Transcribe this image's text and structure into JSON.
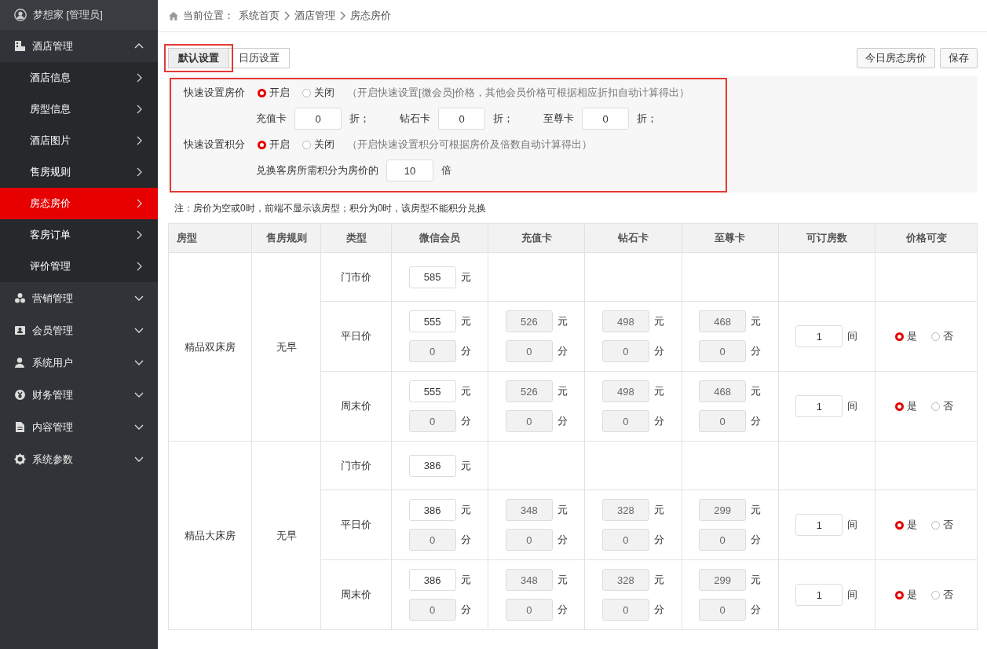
{
  "sidebar": {
    "user": "梦想家 [管理员]",
    "menu": [
      {
        "label": "酒店管理",
        "expanded": true,
        "children": [
          {
            "label": "酒店信息",
            "selected": false
          },
          {
            "label": "房型信息",
            "selected": false
          },
          {
            "label": "酒店图片",
            "selected": false
          },
          {
            "label": "售房规则",
            "selected": false
          },
          {
            "label": "房态房价",
            "selected": true
          },
          {
            "label": "客房订单",
            "selected": false
          },
          {
            "label": "评价管理",
            "selected": false
          }
        ]
      },
      {
        "label": "营销管理",
        "expanded": false
      },
      {
        "label": "会员管理",
        "expanded": false
      },
      {
        "label": "系统用户",
        "expanded": false
      },
      {
        "label": "财务管理",
        "expanded": false
      },
      {
        "label": "内容管理",
        "expanded": false
      },
      {
        "label": "系统参数",
        "expanded": false
      }
    ]
  },
  "breadcrumb": {
    "prefix": "当前位置：",
    "items": [
      "系统首页",
      "酒店管理",
      "房态房价"
    ]
  },
  "tabs": [
    {
      "label": "默认设置",
      "selected": true,
      "annotated": true
    },
    {
      "label": "日历设置",
      "selected": false,
      "annotated": false
    }
  ],
  "toolbar_buttons": [
    "今日房态房价",
    "保存"
  ],
  "quick_settings": {
    "annotated": true,
    "price": {
      "label": "快速设置房价",
      "options": [
        {
          "label": "开启",
          "selected": true
        },
        {
          "label": "关闭",
          "selected": false
        }
      ],
      "hint": "（开启快速设置[微会员]价格，其他会员价格可根据相应折扣自动计算得出）",
      "discounts": [
        {
          "label": "充值卡",
          "value": "0",
          "unit": "折；"
        },
        {
          "label": "钻石卡",
          "value": "0",
          "unit": "折；"
        },
        {
          "label": "至尊卡",
          "value": "0",
          "unit": "折；"
        }
      ]
    },
    "points": {
      "label": "快速设置积分",
      "options": [
        {
          "label": "开启",
          "selected": true
        },
        {
          "label": "关闭",
          "selected": false
        }
      ],
      "hint": "（开启快速设置积分可根据房价及倍数自动计算得出）",
      "ratio_label": "兑换客房所需积分为房价的",
      "ratio_value": "10",
      "ratio_unit": "倍"
    }
  },
  "note": "注：房价为空或0时，前端不显示该房型；积分为0时，该房型不能积分兑换",
  "table": {
    "columns": [
      "房型",
      "售房规则",
      "类型",
      "微信会员",
      "充值卡",
      "钻石卡",
      "至尊卡",
      "可订房数",
      "价格可变"
    ],
    "rooms": [
      {
        "name": "精品双床房",
        "rule": "无早",
        "rates": [
          {
            "kind": "market",
            "type": "门市价",
            "price": {
              "value": "585",
              "unit": "元"
            }
          },
          {
            "kind": "priced",
            "type": "平日价",
            "prices": [
              {
                "value": "555",
                "unit": "元",
                "disabled": false
              },
              {
                "value": "526",
                "unit": "元",
                "disabled": true
              },
              {
                "value": "498",
                "unit": "元",
                "disabled": true
              },
              {
                "value": "468",
                "unit": "元",
                "disabled": true
              }
            ],
            "points": [
              {
                "value": "0",
                "unit": "分",
                "disabled": true
              },
              {
                "value": "0",
                "unit": "分",
                "disabled": true
              },
              {
                "value": "0",
                "unit": "分",
                "disabled": true
              },
              {
                "value": "0",
                "unit": "分",
                "disabled": true
              }
            ],
            "rooms": {
              "value": "1",
              "unit": "间"
            },
            "options": [
              {
                "label": "是",
                "selected": true
              },
              {
                "label": "否",
                "selected": false
              }
            ]
          },
          {
            "kind": "priced",
            "type": "周末价",
            "prices": [
              {
                "value": "555",
                "unit": "元",
                "disabled": false
              },
              {
                "value": "526",
                "unit": "元",
                "disabled": true
              },
              {
                "value": "498",
                "unit": "元",
                "disabled": true
              },
              {
                "value": "468",
                "unit": "元",
                "disabled": true
              }
            ],
            "points": [
              {
                "value": "0",
                "unit": "分",
                "disabled": true
              },
              {
                "value": "0",
                "unit": "分",
                "disabled": true
              },
              {
                "value": "0",
                "unit": "分",
                "disabled": true
              },
              {
                "value": "0",
                "unit": "分",
                "disabled": true
              }
            ],
            "rooms": {
              "value": "1",
              "unit": "间"
            },
            "options": [
              {
                "label": "是",
                "selected": true
              },
              {
                "label": "否",
                "selected": false
              }
            ]
          }
        ]
      },
      {
        "name": "精品大床房",
        "rule": "无早",
        "rates": [
          {
            "kind": "market",
            "type": "门市价",
            "price": {
              "value": "386",
              "unit": "元"
            }
          },
          {
            "kind": "priced",
            "type": "平日价",
            "prices": [
              {
                "value": "386",
                "unit": "元",
                "disabled": false
              },
              {
                "value": "348",
                "unit": "元",
                "disabled": true
              },
              {
                "value": "328",
                "unit": "元",
                "disabled": true
              },
              {
                "value": "299",
                "unit": "元",
                "disabled": true
              }
            ],
            "points": [
              {
                "value": "0",
                "unit": "分",
                "disabled": true
              },
              {
                "value": "0",
                "unit": "分",
                "disabled": true
              },
              {
                "value": "0",
                "unit": "分",
                "disabled": true
              },
              {
                "value": "0",
                "unit": "分",
                "disabled": true
              }
            ],
            "rooms": {
              "value": "1",
              "unit": "间"
            },
            "options": [
              {
                "label": "是",
                "selected": true
              },
              {
                "label": "否",
                "selected": false
              }
            ]
          },
          {
            "kind": "priced",
            "type": "周末价",
            "prices": [
              {
                "value": "386",
                "unit": "元",
                "disabled": false
              },
              {
                "value": "348",
                "unit": "元",
                "disabled": true
              },
              {
                "value": "328",
                "unit": "元",
                "disabled": true
              },
              {
                "value": "299",
                "unit": "元",
                "disabled": true
              }
            ],
            "points": [
              {
                "value": "0",
                "unit": "分",
                "disabled": true
              },
              {
                "value": "0",
                "unit": "分",
                "disabled": true
              },
              {
                "value": "0",
                "unit": "分",
                "disabled": true
              },
              {
                "value": "0",
                "unit": "分",
                "disabled": true
              }
            ],
            "rooms": {
              "value": "1",
              "unit": "间"
            },
            "options": [
              {
                "label": "是",
                "selected": true
              },
              {
                "label": "否",
                "selected": false
              }
            ]
          }
        ]
      }
    ]
  }
}
